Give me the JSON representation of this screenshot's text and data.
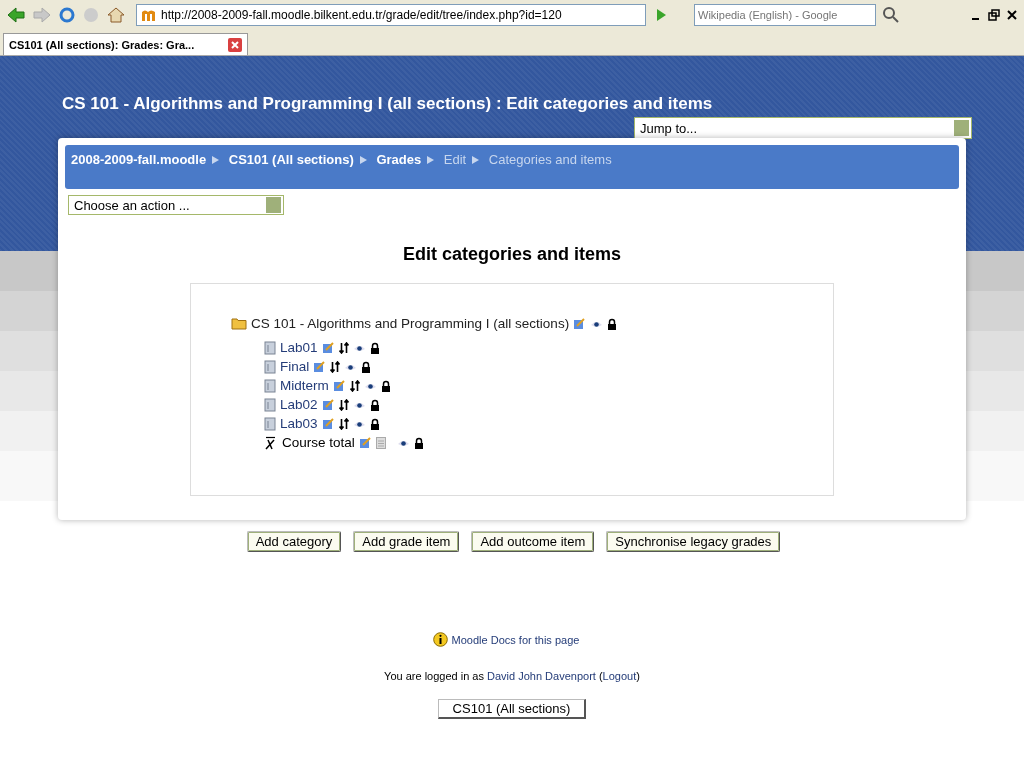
{
  "browser": {
    "url": "http://2008-2009-fall.moodle.bilkent.edu.tr/grade/edit/tree/index.php?id=120",
    "search_placeholder": "Wikipedia (English) - Google",
    "tab_title": "CS101 (All sections): Grades: Gra..."
  },
  "page": {
    "title": "CS 101 - Algorithms and Programming I (all sections) : Edit categories and items",
    "jump_to": "Jump to...",
    "breadcrumb": [
      {
        "label": "2008-2009-fall.moodle",
        "kind": "link"
      },
      {
        "label": "CS101 (All sections)",
        "kind": "link"
      },
      {
        "label": "Grades",
        "kind": "link"
      },
      {
        "label": "Edit",
        "kind": "current"
      },
      {
        "label": "Categories and items",
        "kind": "current"
      }
    ],
    "action_select": "Choose an action ...",
    "heading": "Edit categories and items",
    "tree": {
      "label": "CS 101 - Algorithms and Programming I (all sections)",
      "children": [
        {
          "label": "Lab01",
          "kind": "item"
        },
        {
          "label": "Final",
          "kind": "item"
        },
        {
          "label": "Midterm",
          "kind": "item"
        },
        {
          "label": "Lab02",
          "kind": "item"
        },
        {
          "label": "Lab03",
          "kind": "item"
        },
        {
          "label": "Course total",
          "kind": "total"
        }
      ]
    },
    "buttons": [
      "Add category",
      "Add grade item",
      "Add outcome item",
      "Synchronise legacy grades"
    ],
    "docs_link": "Moodle Docs for this page",
    "login": {
      "prefix": "You are logged in as",
      "user": "David John Davenport",
      "open": "(",
      "logout": "Logout",
      "close": ")"
    },
    "course_button": "CS101 (All sections)"
  }
}
